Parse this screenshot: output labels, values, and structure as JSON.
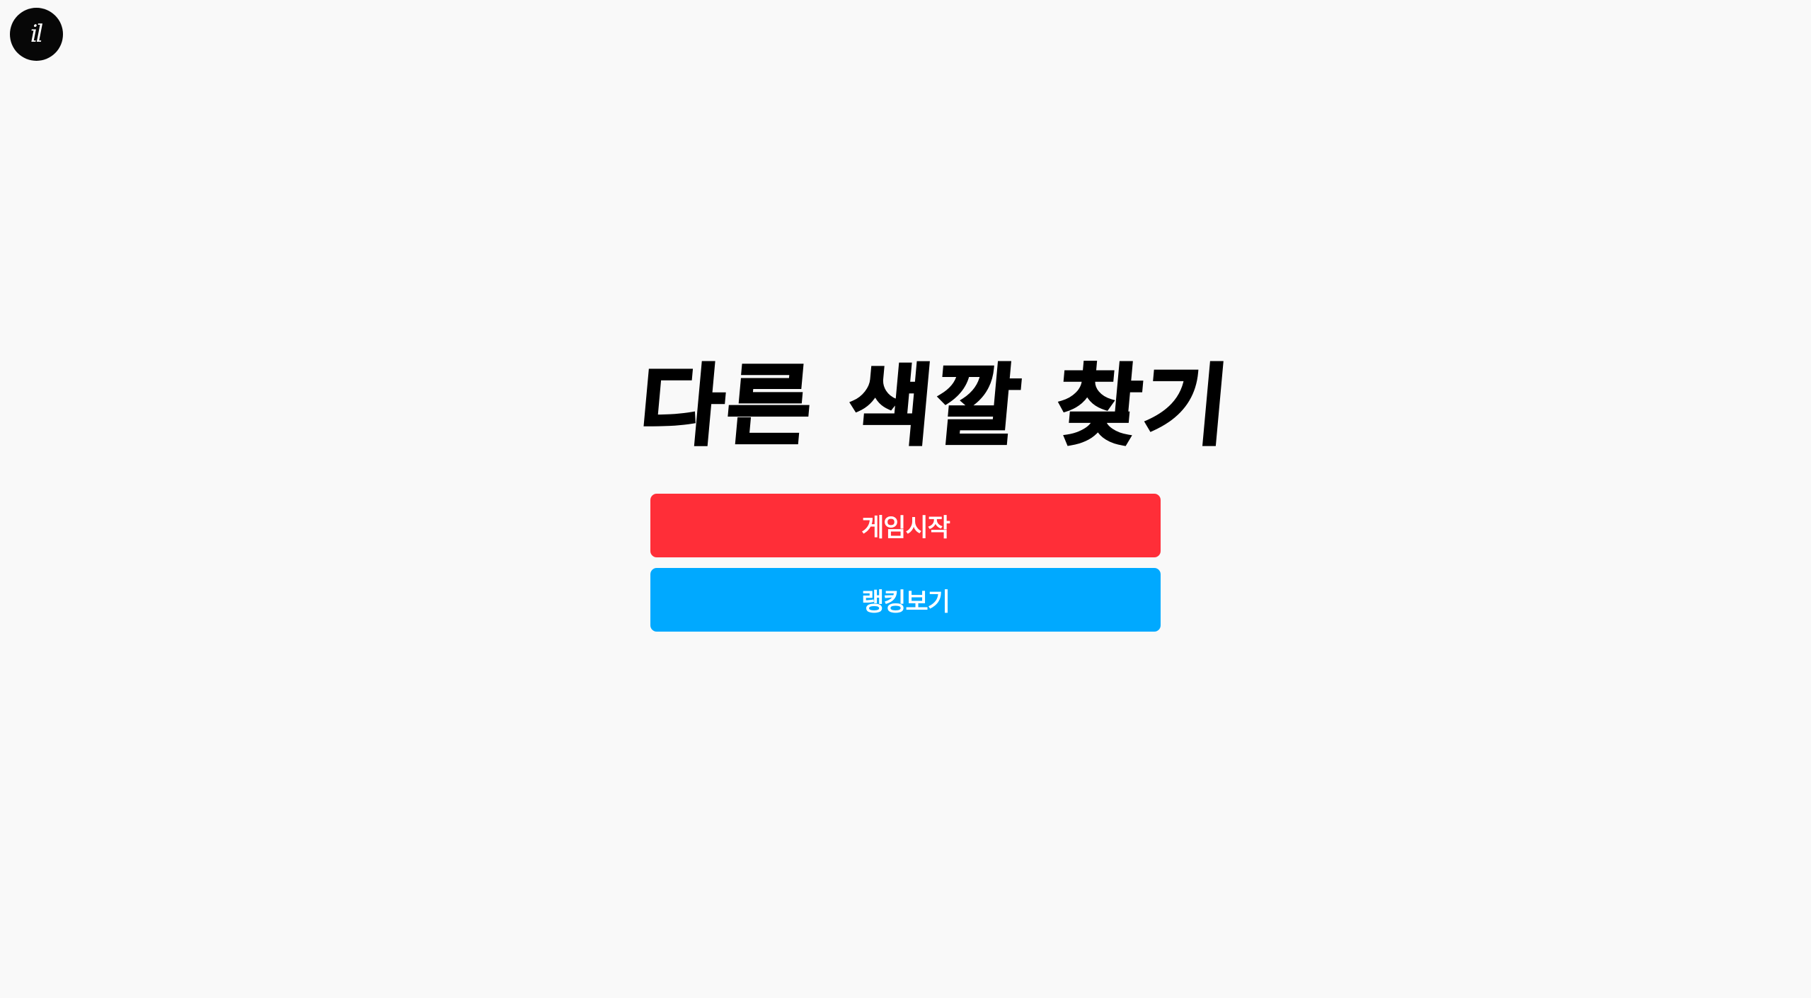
{
  "logo": {
    "text": "il"
  },
  "main": {
    "title": "다른 색깔 찾기",
    "start_button_label": "게임시작",
    "ranking_button_label": "랭킹보기"
  },
  "colors": {
    "background": "#f9f9f9",
    "start_button": "#ff2e38",
    "ranking_button": "#00a9ff",
    "title_text": "#000000",
    "logo_background": "#070707"
  }
}
